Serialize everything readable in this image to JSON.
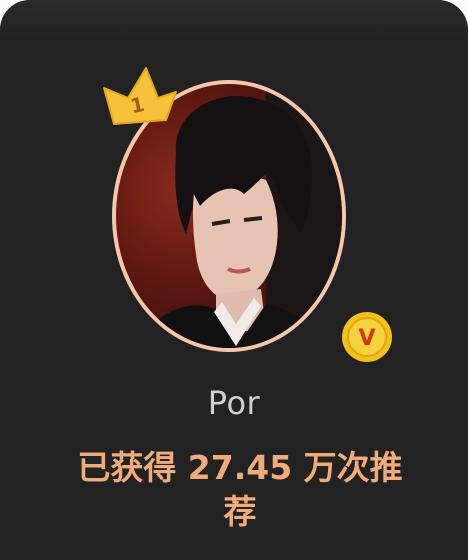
{
  "profile": {
    "name": "Por",
    "recommend_text": "已获得 27.45 万次推荐",
    "rank_badge": "1",
    "verified_mark": "V"
  },
  "icons": {
    "crown": "crown-icon",
    "verified": "verified-badge-icon"
  },
  "colors": {
    "card_bg": "#222222",
    "ring": "#f4c7a8",
    "crown": "#f7c23a",
    "verified": "#f2c11a",
    "stat_text": "#f0ab7a",
    "name_text": "#cfcfcf"
  }
}
